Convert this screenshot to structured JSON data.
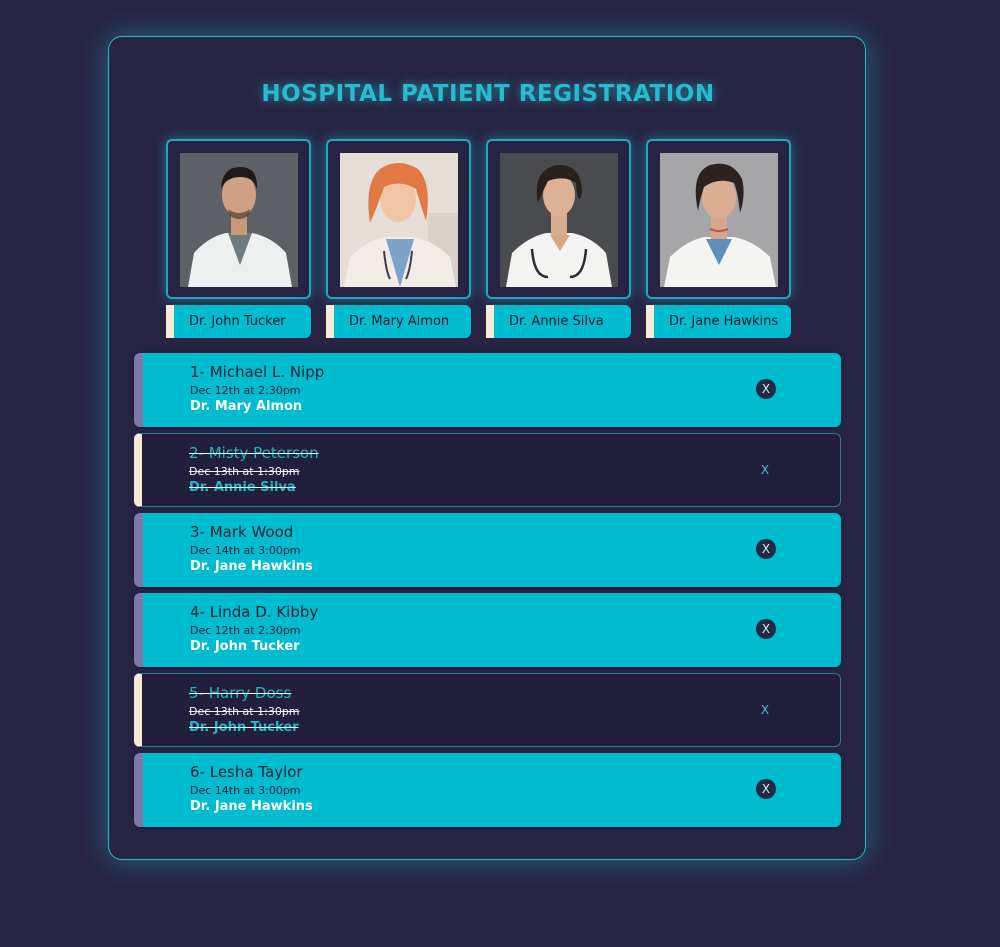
{
  "page": {
    "title": "HOSPITAL PATIENT REGISTRATION"
  },
  "colors": {
    "background": "#272443",
    "accent": "#00bcd0",
    "done_border": "#f7ebd6",
    "active_border": "#7c79a7"
  },
  "doctors": [
    {
      "name": "Dr. John Tucker"
    },
    {
      "name": "Dr. Mary Almon"
    },
    {
      "name": "Dr. Annie Silva"
    },
    {
      "name": "Dr. Jane Hawkins"
    }
  ],
  "appointments": [
    {
      "name": "1- Michael L. Nipp",
      "time": "Dec 12th at 2:30pm",
      "doctor": "Dr. Mary Almon",
      "status": "active",
      "delete_label": "X"
    },
    {
      "name": "2- Misty Peterson",
      "time": "Dec 13th at 1:30pm",
      "doctor": "Dr. Annie Silva",
      "status": "done",
      "delete_label": "X"
    },
    {
      "name": "3- Mark Wood",
      "time": "Dec 14th at 3:00pm",
      "doctor": "Dr. Jane Hawkins",
      "status": "active",
      "delete_label": "X"
    },
    {
      "name": "4- Linda D. Kibby",
      "time": "Dec 12th at 2:30pm",
      "doctor": "Dr. John Tucker",
      "status": "active",
      "delete_label": "X"
    },
    {
      "name": "5- Harry Doss",
      "time": "Dec 13th at 1:30pm",
      "doctor": "Dr. John Tucker",
      "status": "done",
      "delete_label": "X"
    },
    {
      "name": "6- Lesha Taylor",
      "time": "Dec 14th at 3:00pm",
      "doctor": "Dr. Jane Hawkins",
      "status": "active",
      "delete_label": "X"
    }
  ]
}
